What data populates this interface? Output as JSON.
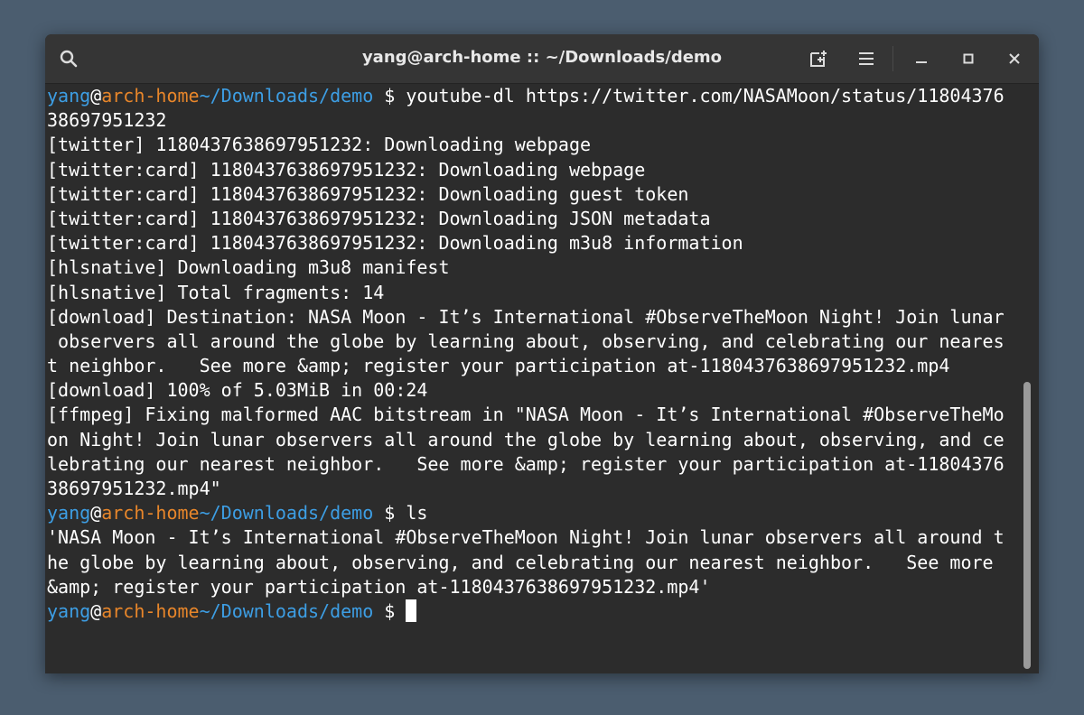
{
  "window": {
    "title": "yang@arch-home :: ~/Downloads/demo"
  },
  "toolbar": {
    "search_icon": "search-icon",
    "new_tab_icon": "new-tab-icon",
    "menu_icon": "hamburger-menu-icon",
    "minimize_icon": "minimize-icon",
    "maximize_icon": "maximize-icon",
    "close_icon": "close-icon"
  },
  "prompt": {
    "user": "yang",
    "at": "@",
    "host": "arch-home",
    "path": "~/Downloads/demo",
    "symbol": " $ "
  },
  "commands": {
    "first": "youtube-dl https://twitter.com/NASAMoon/status/11804376",
    "second": "ls"
  },
  "output": [
    "38697951232",
    "[twitter] 1180437638697951232: Downloading webpage",
    "[twitter:card] 1180437638697951232: Downloading webpage",
    "[twitter:card] 1180437638697951232: Downloading guest token",
    "[twitter:card] 1180437638697951232: Downloading JSON metadata",
    "[twitter:card] 1180437638697951232: Downloading m3u8 information",
    "[hlsnative] Downloading m3u8 manifest",
    "[hlsnative] Total fragments: 14",
    "[download] Destination: NASA Moon - It’s International #ObserveTheMoon Night! Join lunar",
    " observers all around the globe by learning about, observing, and celebrating our neares",
    "t neighbor.   See more &amp; register your participation at-1180437638697951232.mp4",
    "[download] 100% of 5.03MiB in 00:24",
    "[ffmpeg] Fixing malformed AAC bitstream in \"NASA Moon - It’s International #ObserveTheMo",
    "on Night! Join lunar observers all around the globe by learning about, observing, and ce",
    "lebrating our nearest neighbor.   See more &amp; register your participation at-11804376",
    "38697951232.mp4\""
  ],
  "ls_output": [
    "'NASA Moon - It’s International #ObserveTheMoon Night! Join lunar observers all around t",
    "he globe by learning about, observing, and celebrating our nearest neighbor.   See more",
    "&amp; register your participation at-1180437638697951232.mp4'"
  ],
  "colors": {
    "user": "#3d9ee4",
    "host": "#e8862a",
    "path": "#3d9ee4",
    "background": "#2c2c2c",
    "titlebar": "#353535"
  }
}
